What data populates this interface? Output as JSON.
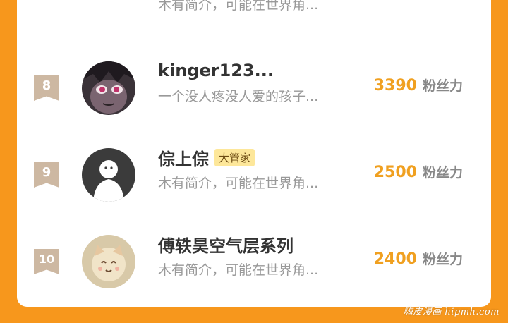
{
  "colors": {
    "background": "#f7971c",
    "card": "#ffffff",
    "score": "#f0a020",
    "rank_badge": "#cdb8a2",
    "tag_bg": "#fde79a"
  },
  "partial_top_row": {
    "bio": "木有简介，可能在世界角..."
  },
  "rows": [
    {
      "rank": "8",
      "name": "kinger123...",
      "tag": "",
      "bio": "一个没人疼没人爱的孩子...",
      "score": "3390",
      "score_unit": "粉丝力",
      "avatar": "anime-avatar"
    },
    {
      "rank": "9",
      "name": "倧上倧",
      "tag": "大管家",
      "bio": "木有简介，可能在世界角...",
      "score": "2500",
      "score_unit": "粉丝力",
      "avatar": "default-avatar"
    },
    {
      "rank": "10",
      "name": "傅轶昊空气层系列",
      "tag": "",
      "bio": "木有简介，可能在世界角...",
      "score": "2400",
      "score_unit": "粉丝力",
      "avatar": "cat-avatar"
    }
  ],
  "watermark": "嗨皮漫画 hipmh.com"
}
